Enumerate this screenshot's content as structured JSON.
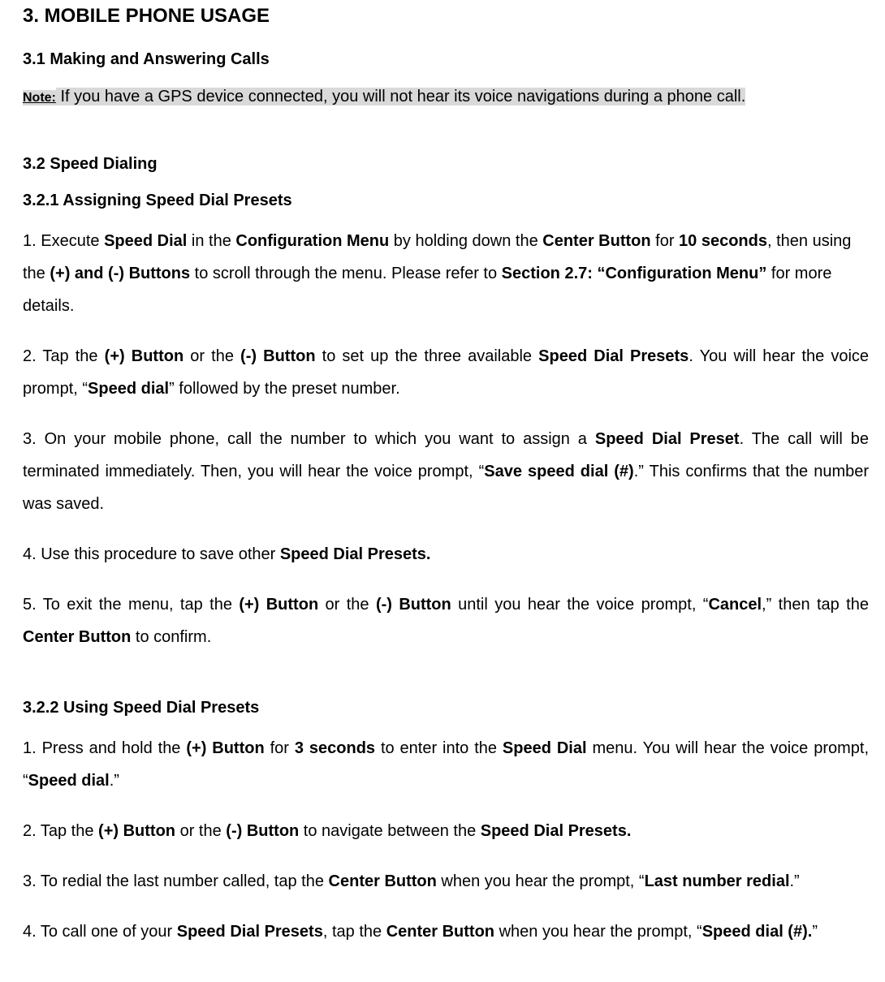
{
  "section": {
    "title": "3. MOBILE PHONE USAGE",
    "s31": {
      "heading": "3.1 Making and Answering Calls",
      "note_label": "Note:",
      "note_text": " If you have a GPS device connected, you will not hear its voice navigations during a phone call."
    },
    "s32": {
      "heading": "3.2 Speed Dialing",
      "s321": {
        "heading": "3.2.1 Assigning Speed Dial Presets",
        "p1": {
          "t1": "1. Execute ",
          "b1": "Speed Dial",
          "t2": " in the ",
          "b2": "Configuration Menu",
          "t3": " by holding down the ",
          "b3": "Center Button",
          "t4": " for ",
          "b4": "10 seconds",
          "t5": ", then using the ",
          "b5": "(+) and (-) Buttons",
          "t6": " to scroll through the menu. Please refer to ",
          "b6": "Section 2.7: “Configuration Menu”",
          "t7": " for more details."
        },
        "p2": {
          "t1": "2. Tap the ",
          "b1": "(+) Button",
          "t2": " or the ",
          "b2": "(-) Button",
          "t3": " to set up the three available ",
          "b3": "Speed Dial Presets",
          "t4": ". You will hear the voice prompt, “",
          "b4": "Speed dial",
          "t5": "” followed by the preset number."
        },
        "p3": {
          "t1": "3. On your mobile phone, call the number to which you want to assign a ",
          "b1": "Speed Dial Preset",
          "t2": ". The call will be terminated immediately. Then, you will hear the voice prompt, “",
          "b2": "Save speed dial (#)",
          "t3": ".” This confirms that the number was saved."
        },
        "p4": {
          "t1": "4. Use this procedure to save other ",
          "b1": "Speed Dial Presets."
        },
        "p5": {
          "t1": "5. To exit the menu, tap the ",
          "b1": "(+) Button",
          "t2": " or the ",
          "b2": "(-) Button",
          "t3": " until you hear the voice prompt, “",
          "b3": "Cancel",
          "t4": ",” then tap the ",
          "b4": "Center Button",
          "t5": " to confirm."
        }
      },
      "s322": {
        "heading": "3.2.2 Using Speed Dial Presets",
        "p1": {
          "t1": "1. Press and hold the ",
          "b1": "(+) Button",
          "t2": " for ",
          "b2": "3 seconds",
          "t3": " to enter into the ",
          "b3": "Speed Dial",
          "t4": " menu. You will hear the voice prompt, “",
          "b4": "Speed dial",
          "t5": ".”"
        },
        "p2": {
          "t1": "2. Tap the ",
          "b1": "(+) Button",
          "t2": " or the ",
          "b2": "(-) Button",
          "t3": " to navigate between the ",
          "b3": "Speed Dial Presets."
        },
        "p3": {
          "t1": "3. To redial the last number called, tap the ",
          "b1": "Center Button",
          "t2": " when you hear the prompt, “",
          "b2": "Last number redial",
          "t3": ".”"
        },
        "p4": {
          "t1": "4. To call one of your ",
          "b1": "Speed Dial Presets",
          "t2": ", tap the ",
          "b2": "Center Button",
          "t3": " when you hear the prompt, “",
          "b3": "Speed dial (#).",
          "t4": "”"
        }
      }
    }
  }
}
